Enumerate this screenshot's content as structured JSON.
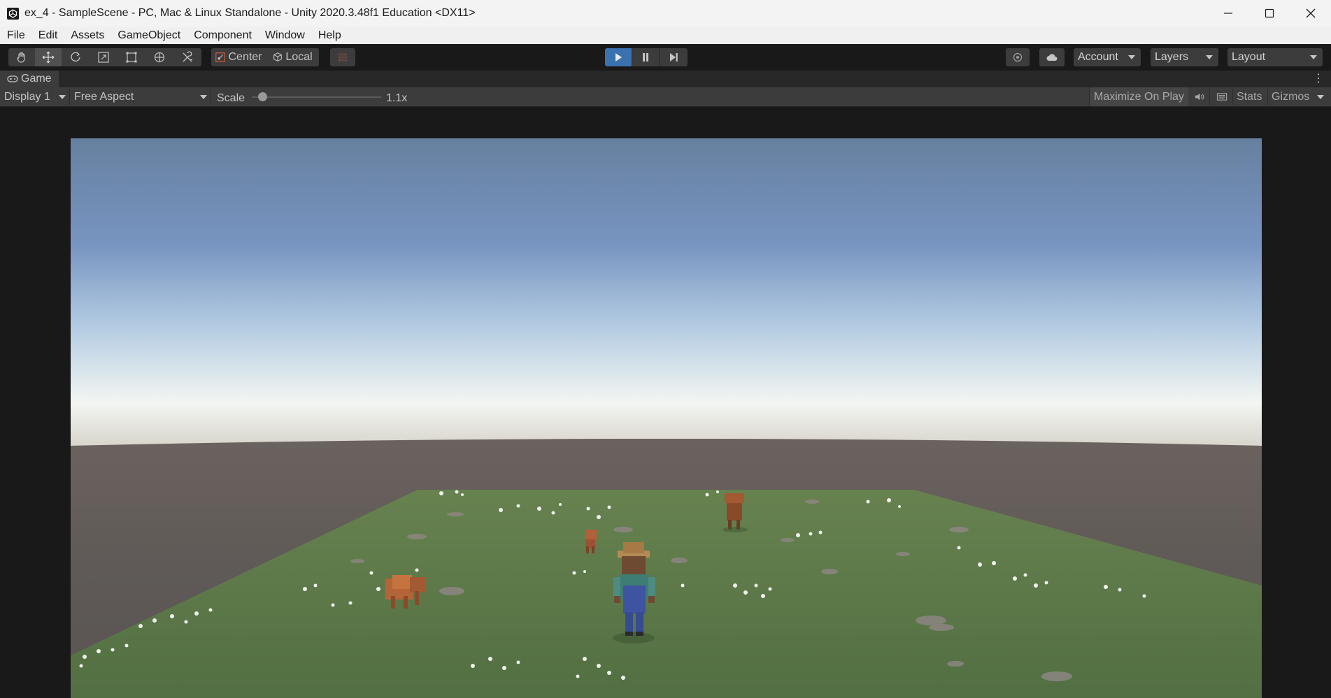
{
  "window": {
    "title": "ex_4 - SampleScene - PC, Mac & Linux Standalone - Unity 2020.3.48f1 Education <DX11>",
    "minimize_icon": "minimize-icon",
    "maximize_icon": "maximize-icon",
    "close_icon": "close-icon"
  },
  "menu": [
    "File",
    "Edit",
    "Assets",
    "GameObject",
    "Component",
    "Window",
    "Help"
  ],
  "toolbar": {
    "tools": [
      "hand-tool-icon",
      "move-tool-icon",
      "rotate-tool-icon",
      "scale-tool-icon",
      "rect-tool-icon",
      "transform-tool-icon",
      "custom-tool-icon"
    ],
    "active_tool": "move-tool-icon",
    "pivot_label": "Center",
    "space_label": "Local",
    "playback": [
      "play-icon",
      "pause-icon",
      "step-icon"
    ],
    "play_active_color": "#3a72b0",
    "account_label": "Account",
    "layers_label": "Layers",
    "layout_label": "Layout"
  },
  "tab": {
    "label": "Game"
  },
  "game_toolbar": {
    "display_label": "Display 1",
    "aspect_label": "Free Aspect",
    "scale_label": "Scale",
    "scale_value": "1.1x",
    "scale_fraction": 0.05,
    "maximize_label": "Maximize On Play",
    "stats_label": "Stats",
    "gizmos_label": "Gizmos"
  },
  "scene": {
    "sky_top_color": "#6b84ac",
    "horizon_color": "#f3f6f2",
    "ground_color": "#655f5b",
    "grass_color": "#5d7a4c"
  }
}
